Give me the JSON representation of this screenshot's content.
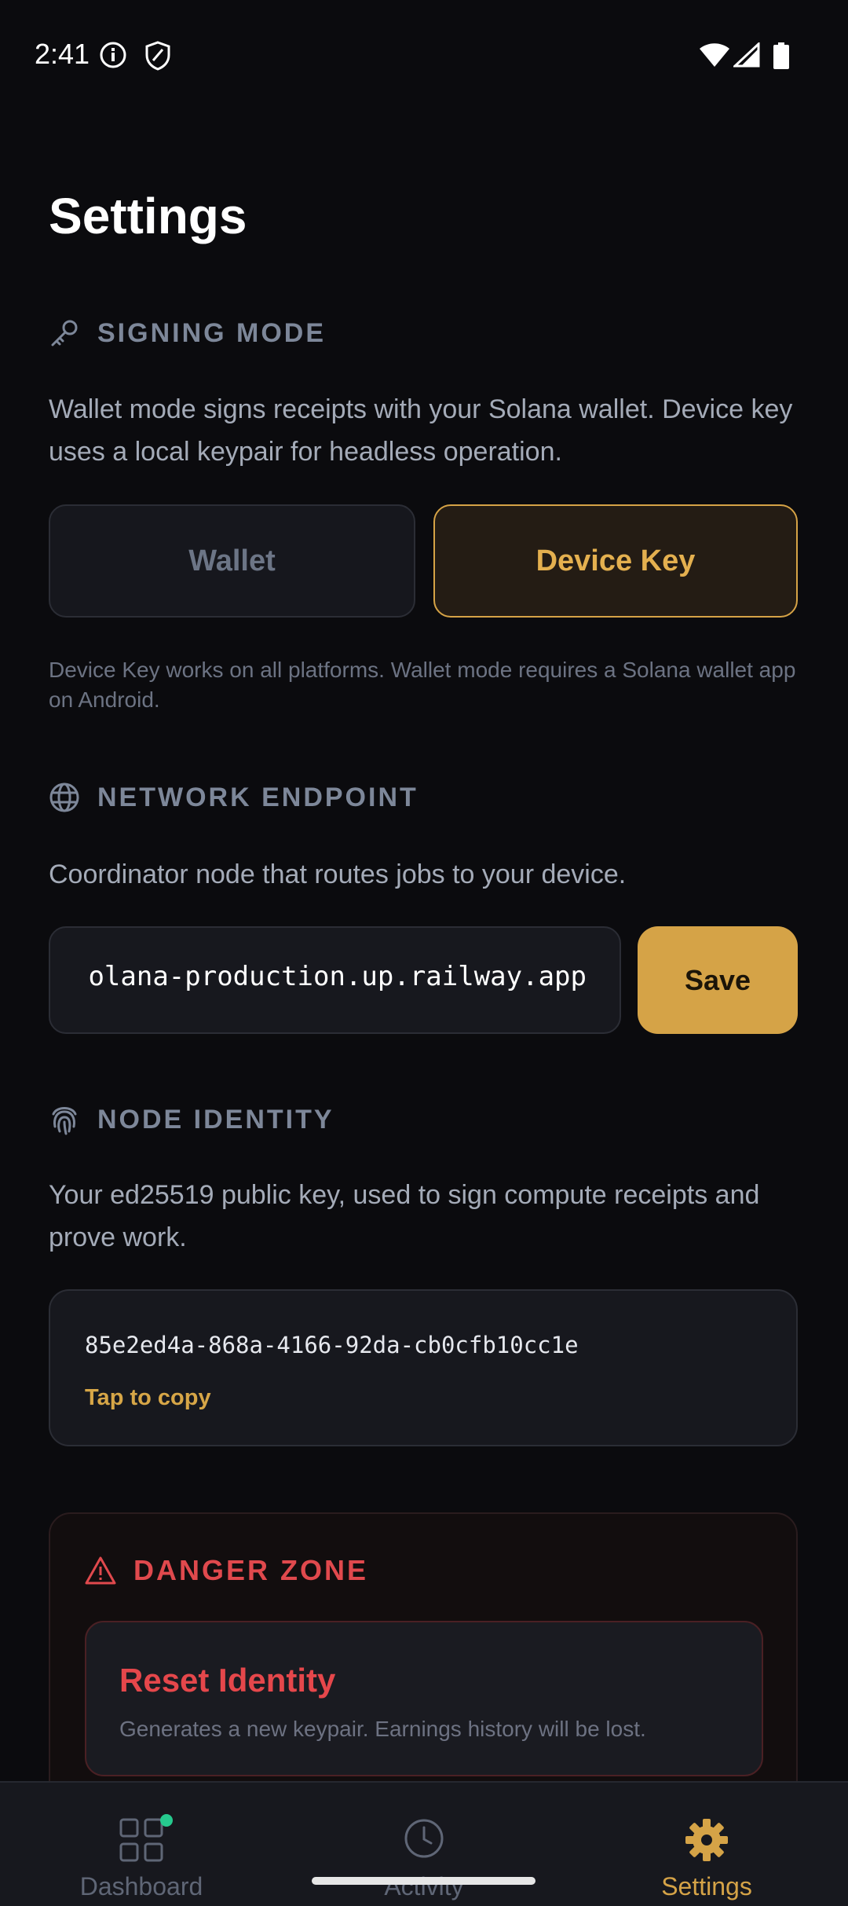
{
  "status_bar": {
    "time": "2:41"
  },
  "page": {
    "title": "Settings"
  },
  "signing_mode": {
    "heading": "SIGNING MODE",
    "description": "Wallet mode signs receipts with your Solana wallet. Device key uses a local keypair for headless operation.",
    "options": [
      "Wallet",
      "Device Key"
    ],
    "selected": "Device Key",
    "note": "Device Key works on all platforms. Wallet mode requires a Solana wallet app on Android."
  },
  "network_endpoint": {
    "heading": "NETWORK ENDPOINT",
    "description": "Coordinator node that routes jobs to your device.",
    "value": "olana-production.up.railway.app",
    "save_label": "Save"
  },
  "node_identity": {
    "heading": "NODE IDENTITY",
    "description": "Your ed25519 public key, used to sign compute receipts and prove work.",
    "key": "85e2ed4a-868a-4166-92da-cb0cfb10cc1e",
    "copy_label": "Tap to copy"
  },
  "danger_zone": {
    "heading": "DANGER ZONE",
    "reset_title": "Reset Identity",
    "reset_description": "Generates a new keypair. Earnings history will be lost."
  },
  "bottom_nav": {
    "items": [
      {
        "label": "Dashboard",
        "icon": "grid-icon"
      },
      {
        "label": "Activity",
        "icon": "clock-icon"
      },
      {
        "label": "Settings",
        "icon": "gear-icon"
      }
    ],
    "active": "Settings"
  },
  "colors": {
    "accent": "#d5a347",
    "danger": "#e0494d",
    "background": "#0b0b0e",
    "muted": "#7d8799",
    "notification_dot": "#26c98e"
  }
}
